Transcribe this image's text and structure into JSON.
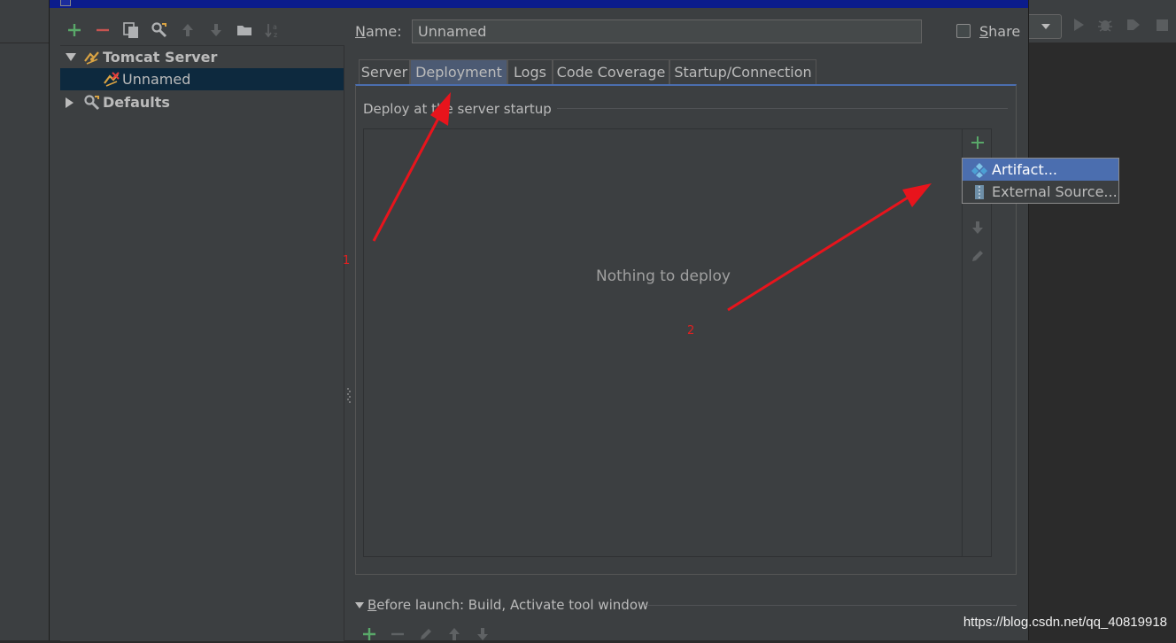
{
  "dialog": {
    "name_label": "Name:",
    "name_value": "Unnamed",
    "share_label": "Share",
    "tree": {
      "items": [
        {
          "label": "Tomcat Server"
        },
        {
          "label": "Unnamed"
        },
        {
          "label": "Defaults"
        }
      ]
    },
    "tabs": [
      {
        "label": "Server"
      },
      {
        "label": "Deployment"
      },
      {
        "label": "Logs"
      },
      {
        "label": "Code Coverage"
      },
      {
        "label": "Startup/Connection"
      }
    ],
    "active_tab": "Deployment",
    "deploy_section_title": "Deploy at the server startup",
    "deploy_empty_text": "Nothing to deploy",
    "popup": {
      "items": [
        {
          "label": "Artifact..."
        },
        {
          "label": "External Source..."
        }
      ]
    },
    "before_launch": "Before launch: Build, Activate tool window"
  },
  "annotations": {
    "label_1": "1",
    "label_2": "2",
    "arrow_color": "#e8141c"
  },
  "watermark": "https://blog.csdn.net/qq_40819918",
  "colors": {
    "accent": "#4b6eaf",
    "add_green": "#59a869",
    "remove_red": "#c75450",
    "title_bar": "#0b1c8c"
  },
  "icons": {
    "toolbar": [
      "add-icon",
      "remove-icon",
      "copy-icon",
      "wrench-icon",
      "move-up-icon",
      "move-down-icon",
      "folder-icon",
      "sort-alpha-icon"
    ],
    "side": [
      "add-icon",
      "move-down-icon",
      "edit-icon"
    ],
    "before_launch": [
      "add-icon",
      "remove-icon",
      "edit-icon",
      "move-up-icon",
      "move-down-icon"
    ]
  }
}
